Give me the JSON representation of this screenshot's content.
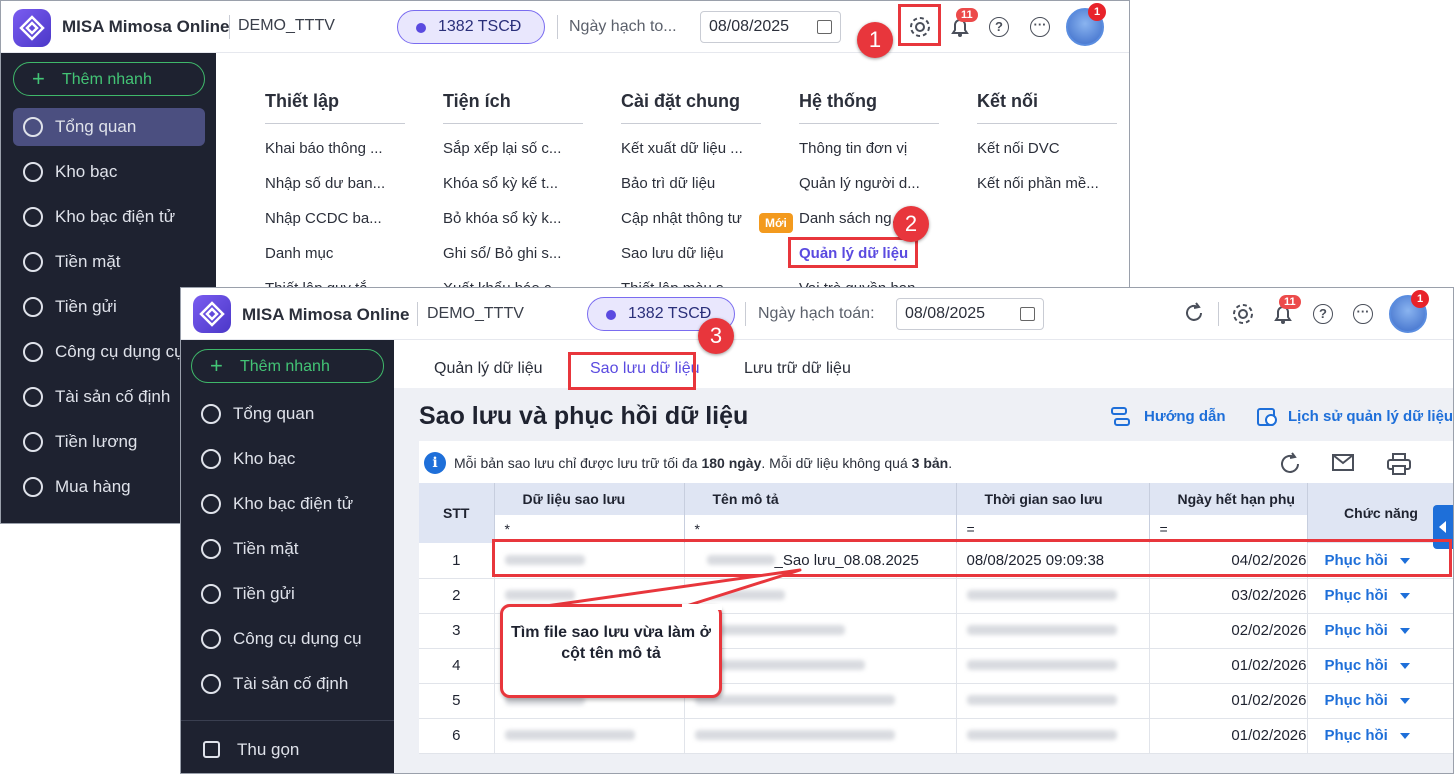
{
  "back_window": {
    "app_name": "MISA Mimosa Online",
    "company": "DEMO_TTTV",
    "tscd_badge": "1382 TSCĐ",
    "date_label": "Ngày hạch to...",
    "date_value": "08/08/2025",
    "notifications_count": "11",
    "avatar_badge": "1",
    "quick_add": "Thêm nhanh",
    "sidebar": [
      "Tổng quan",
      "Kho bạc",
      "Kho bạc điện tử",
      "Tiền mặt",
      "Tiền gửi",
      "Công cụ dụng cụ",
      "Tài sản cố định",
      "Tiền lương",
      "Mua hàng"
    ],
    "menu": [
      {
        "title": "Thiết lập",
        "items": [
          "Khai báo thông ...",
          "Nhập số dư ban...",
          "Nhập CCDC ba...",
          "Danh mục",
          "Thiết lập quy tắ..."
        ]
      },
      {
        "title": "Tiện ích",
        "items": [
          "Sắp xếp lại số c...",
          "Khóa sổ kỳ kế t...",
          "Bỏ khóa sổ kỳ k...",
          "Ghi sổ/ Bỏ ghi s...",
          "Xuất khẩu báo c..."
        ]
      },
      {
        "title": "Cài đặt chung",
        "items": [
          "Kết xuất dữ liệu ...",
          "Bảo trì dữ liệu",
          "Cập nhật thông tư",
          "Sao lưu dữ liệu",
          "Thiết lập màu s..."
        ]
      },
      {
        "title": "Hệ thống",
        "items": [
          "Thông tin đơn vị",
          "Quản lý người d...",
          "Danh sách ng...",
          "Quản lý dữ liệu",
          "Vai trò quyền hạn"
        ]
      },
      {
        "title": "Kết nối",
        "items": [
          "Kết nối DVC",
          "Kết nối phần mề..."
        ]
      }
    ],
    "new_tag": "Mới"
  },
  "front_window": {
    "app_name": "MISA Mimosa Online",
    "company": "DEMO_TTTV",
    "tscd_badge": "1382 TSCĐ",
    "date_label": "Ngày hạch toán:",
    "date_value": "08/08/2025",
    "notifications_count": "11",
    "avatar_badge": "1",
    "quick_add": "Thêm nhanh",
    "sidebar": [
      "Tổng quan",
      "Kho bạc",
      "Kho bạc điện tử",
      "Tiền mặt",
      "Tiền gửi",
      "Công cụ dụng cụ",
      "Tài sản cố định"
    ],
    "collapse": "Thu gọn",
    "tabs": [
      "Quản lý dữ liệu",
      "Sao lưu dữ liệu",
      "Lưu trữ dữ liệu"
    ],
    "title": "Sao lưu và phục hồi dữ liệu",
    "guide_link": "Hướng dẫn",
    "history_link": "Lịch sử quản lý dữ liệu",
    "info_text_1": "Mỗi bản sao lưu chỉ được lưu trữ tối đa ",
    "info_bold_1": "180 ngày",
    "info_text_2": ". Mỗi dữ liệu không quá ",
    "info_bold_2": "3 bản",
    "info_text_3": ".",
    "columns": [
      "STT",
      "Dữ liệu sao lưu",
      "Tên mô tả",
      "Thời gian sao lưu",
      "Ngày hết hạn phụ",
      "Chức năng"
    ],
    "filters": [
      "*",
      "*",
      "=",
      "="
    ],
    "rows": [
      {
        "stt": "1",
        "data": "",
        "desc": "_Sao lưu_08.08.2025",
        "time": "08/08/2025 09:09:38",
        "expire": "04/02/2026",
        "action": "Phục hồi"
      },
      {
        "stt": "2",
        "data": "",
        "desc": "",
        "time": "",
        "expire": "03/02/2026",
        "action": "Phục hồi"
      },
      {
        "stt": "3",
        "data": "",
        "desc": "",
        "time": "",
        "expire": "02/02/2026",
        "action": "Phục hồi"
      },
      {
        "stt": "4",
        "data": "",
        "desc": "",
        "time": "",
        "expire": "01/02/2026",
        "action": "Phục hồi"
      },
      {
        "stt": "5",
        "data": "",
        "desc": "",
        "time": "",
        "expire": "01/02/2026",
        "action": "Phục hồi"
      },
      {
        "stt": "6",
        "data": "",
        "desc": "",
        "time": "",
        "expire": "01/02/2026",
        "action": "Phục hồi"
      }
    ]
  },
  "annotations": {
    "steps": [
      "1",
      "2",
      "3"
    ],
    "callout": "Tìm file sao lưu vừa làm ở cột tên mô tả"
  }
}
